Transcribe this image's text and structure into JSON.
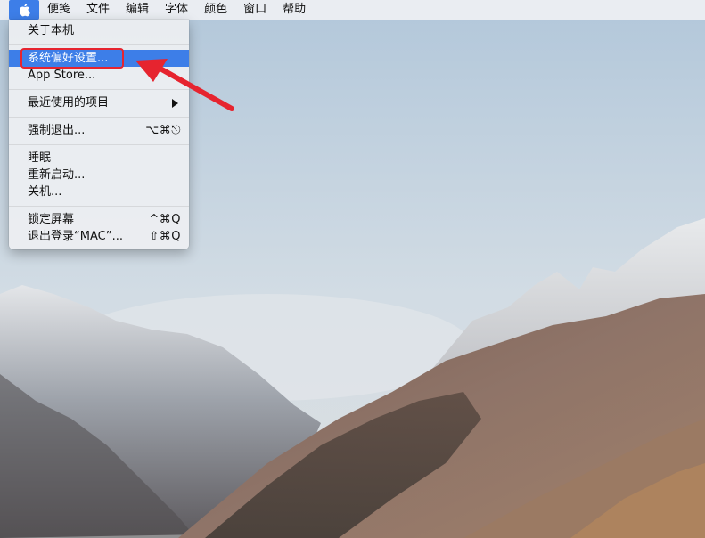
{
  "menubar": {
    "apple_icon": "apple-logo-icon",
    "items": [
      "便笺",
      "文件",
      "编辑",
      "字体",
      "颜色",
      "窗口",
      "帮助"
    ]
  },
  "apple_menu": {
    "about": "关于本机",
    "system_prefs": "系统偏好设置...",
    "app_store": "App Store...",
    "recent_items": "最近使用的项目",
    "force_quit": {
      "label": "强制退出...",
      "shortcut": "⌥⌘⎋"
    },
    "sleep": "睡眠",
    "restart": "重新启动...",
    "shutdown": "关机...",
    "lock_screen": {
      "label": "锁定屏幕",
      "shortcut": "^⌘Q"
    },
    "logout": {
      "label": "退出登录“MAC”...",
      "shortcut": "⇧⌘Q"
    }
  },
  "annotation": {
    "color": "#e6242f",
    "target": "system_prefs"
  },
  "colors": {
    "menu_highlight": "#3d7ee8"
  }
}
